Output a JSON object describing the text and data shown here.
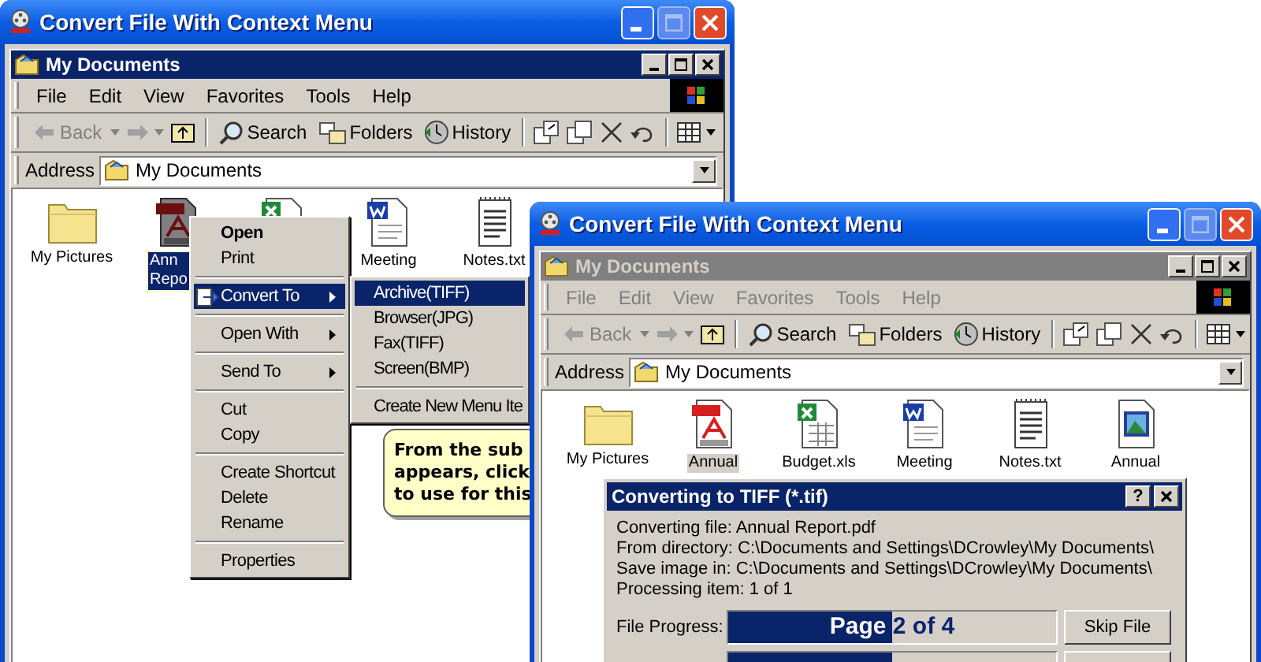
{
  "windows": [
    {
      "title": "Convert File With Context Menu",
      "explorer": {
        "title": "My Documents",
        "active": true,
        "menu": [
          "File",
          "Edit",
          "View",
          "Favorites",
          "Tools",
          "Help"
        ],
        "toolbar": {
          "back": "Back",
          "back_disabled": true,
          "search": "Search",
          "folders": "Folders",
          "history": "History"
        },
        "address_label": "Address",
        "address": "My Documents",
        "files": [
          {
            "kind": "folder",
            "label": [
              "My Pictures"
            ],
            "selected": false
          },
          {
            "kind": "pdf",
            "label": [
              "Ann",
              "Repo"
            ],
            "selected": true,
            "clipped": true
          },
          {
            "kind": "xls"
          },
          {
            "kind": "doc",
            "label": [
              "Meeting"
            ],
            "selected": false
          },
          {
            "kind": "txt",
            "label": [
              "Notes.txt"
            ],
            "selected": false
          }
        ]
      },
      "context_menu": [
        {
          "kind": "item",
          "label": "Open",
          "bold": true,
          "selected": false
        },
        {
          "kind": "item",
          "label": "Print",
          "selected": false
        },
        {
          "kind": "separator"
        },
        {
          "kind": "item",
          "label": "Convert To",
          "has_icon": true,
          "has_submenu": true,
          "selected": true
        },
        {
          "kind": "separator"
        },
        {
          "kind": "item",
          "label": "Open With",
          "has_submenu": true,
          "selected": false
        },
        {
          "kind": "separator"
        },
        {
          "kind": "item",
          "label": "Send To",
          "has_submenu": true,
          "selected": false
        },
        {
          "kind": "separator"
        },
        {
          "kind": "item",
          "label": "Cut",
          "selected": false
        },
        {
          "kind": "item",
          "label": "Copy",
          "selected": false
        },
        {
          "kind": "separator"
        },
        {
          "kind": "item",
          "label": "Create Shortcut",
          "selected": false
        },
        {
          "kind": "item",
          "label": "Delete",
          "selected": false
        },
        {
          "kind": "item",
          "label": "Rename",
          "selected": false
        },
        {
          "kind": "separator"
        },
        {
          "kind": "item",
          "label": "Properties",
          "selected": false
        }
      ],
      "submenu": [
        {
          "kind": "item",
          "label": "Archive(TIFF)",
          "selected": true
        },
        {
          "kind": "item",
          "label": "Browser(JPG)",
          "selected": false
        },
        {
          "kind": "item",
          "label": "Fax(TIFF)",
          "selected": false
        },
        {
          "kind": "item",
          "label": "Screen(BMP)",
          "selected": false
        },
        {
          "kind": "separator"
        },
        {
          "kind": "item",
          "label": "Create New Menu Ite",
          "selected": false
        }
      ],
      "tip": [
        "From the sub",
        "appears, click",
        "to use for this"
      ]
    },
    {
      "title": "Convert File With Context Menu",
      "explorer": {
        "title": "My Documents",
        "active": false,
        "menu": [
          "File",
          "Edit",
          "View",
          "Favorites",
          "Tools",
          "Help"
        ],
        "toolbar": {
          "back": "Back",
          "back_disabled": true,
          "search": "Search",
          "folders": "Folders",
          "history": "History"
        },
        "address_label": "Address",
        "address": "My Documents",
        "files": [
          {
            "kind": "folder",
            "label": [
              "My Pictures"
            ],
            "selected": false
          },
          {
            "kind": "pdf",
            "label": [
              "Annual"
            ],
            "selected": true
          },
          {
            "kind": "xls",
            "label": [
              "Budget.xls"
            ],
            "selected": false
          },
          {
            "kind": "doc",
            "label": [
              "Meeting"
            ],
            "selected": false
          },
          {
            "kind": "txt",
            "label": [
              "Notes.txt"
            ],
            "selected": false
          },
          {
            "kind": "tif",
            "label": [
              "Annual"
            ],
            "selected": false
          }
        ]
      },
      "dialog": {
        "title": "Converting to TIFF (*.tif)",
        "help": "?",
        "lines": [
          "Converting file: Annual Report.pdf",
          "From directory: C:\\Documents and Settings\\DCrowley\\My Documents\\",
          "Save image in: C:\\Documents and Settings\\DCrowley\\My Documents\\",
          "Processing item: 1 of 1"
        ],
        "rows": [
          {
            "label": "File Progress:",
            "level": 0.5,
            "text": "Page 2 of 4",
            "button": "Skip File"
          },
          {
            "level": 0.5
          }
        ]
      }
    }
  ]
}
